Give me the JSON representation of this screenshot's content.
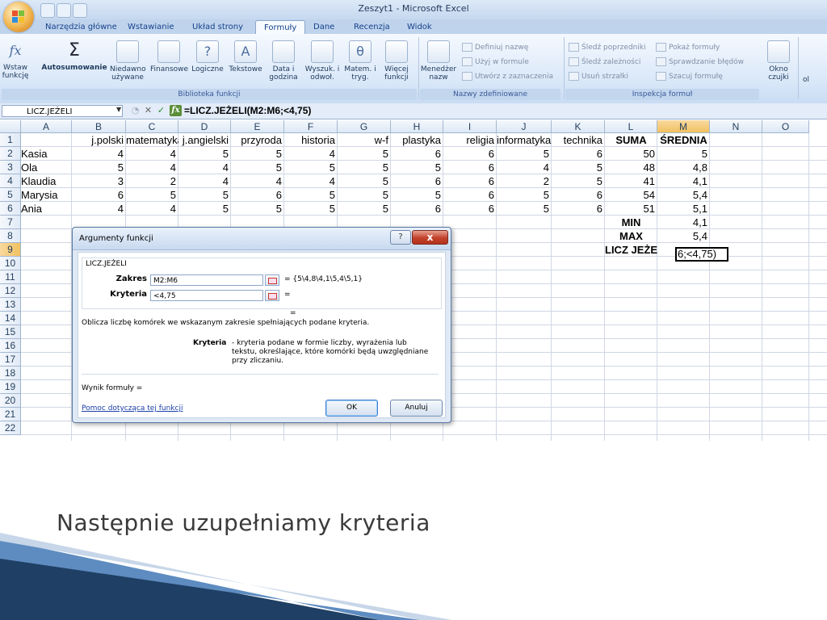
{
  "window": {
    "title": "Zeszyt1 - Microsoft Excel"
  },
  "tabs": [
    {
      "label": "Narzędzia główne"
    },
    {
      "label": "Wstawianie"
    },
    {
      "label": "Układ strony"
    },
    {
      "label": "Formuły",
      "active": true
    },
    {
      "label": "Dane"
    },
    {
      "label": "Recenzja"
    },
    {
      "label": "Widok"
    }
  ],
  "ribbon": {
    "insert_function": "Wstaw funkcję",
    "autosum": "Autosumowanie",
    "recent": "Niedawno używane",
    "financial": "Finansowe",
    "logical": "Logiczne",
    "text": "Tekstowe",
    "datetime": "Data i godzina",
    "lookup": "Wyszuk. i odwoł.",
    "math": "Matem. i tryg.",
    "more": "Więcej funkcji",
    "library_group": "Biblioteka funkcji",
    "name_manager": "Menedżer nazw",
    "define_name": "Definiuj nazwę",
    "use_in_formula": "Użyj w formule",
    "create_from_selection": "Utwórz z zaznaczenia",
    "names_group": "Nazwy zdefiniowane",
    "trace_precedents": "Śledź poprzedniki",
    "trace_dependents": "Śledź zależności",
    "remove_arrows": "Usuń strzałki",
    "show_formulas": "Pokaż formuły",
    "error_checking": "Sprawdzanie błędów",
    "evaluate_formula": "Szacuj formułę",
    "audit_group": "Inspekcja formuł",
    "watch_window": "Okno czujki",
    "calc_partial": "ol"
  },
  "formula_bar": {
    "name_box": "LICZ.JEŻELI",
    "formula": "=LICZ.JEŻELI(M2:M6;<4,75)"
  },
  "columns": [
    "A",
    "B",
    "C",
    "D",
    "E",
    "F",
    "G",
    "H",
    "I",
    "J",
    "K",
    "L",
    "M",
    "N",
    "O"
  ],
  "rows": [
    "1",
    "2",
    "3",
    "4",
    "5",
    "6",
    "7",
    "8",
    "9",
    "10",
    "11",
    "12",
    "13",
    "14",
    "15",
    "16",
    "17",
    "18",
    "19",
    "20",
    "21",
    "22"
  ],
  "sheet": {
    "headers": [
      "j.polski",
      "matematyka",
      "j.angielski",
      "przyroda",
      "historia",
      "w-f",
      "plastyka",
      "religia",
      "informatyka",
      "technika",
      "SUMA",
      "ŚREDNIA"
    ],
    "students": [
      {
        "name": "Kasia",
        "grades": [
          "4",
          "4",
          "5",
          "5",
          "4",
          "5",
          "6",
          "6",
          "5",
          "6"
        ],
        "sum": "50",
        "avg": "5"
      },
      {
        "name": "Ola",
        "grades": [
          "5",
          "4",
          "4",
          "5",
          "5",
          "5",
          "5",
          "6",
          "4",
          "5"
        ],
        "sum": "48",
        "avg": "4,8"
      },
      {
        "name": "Klaudia",
        "grades": [
          "3",
          "2",
          "4",
          "4",
          "4",
          "5",
          "6",
          "6",
          "2",
          "5"
        ],
        "sum": "41",
        "avg": "4,1"
      },
      {
        "name": "Marysia",
        "grades": [
          "6",
          "5",
          "5",
          "6",
          "5",
          "5",
          "5",
          "6",
          "5",
          "6"
        ],
        "sum": "54",
        "avg": "5,4"
      },
      {
        "name": "Ania",
        "grades": [
          "4",
          "4",
          "5",
          "5",
          "5",
          "5",
          "6",
          "6",
          "5",
          "6"
        ],
        "sum": "51",
        "avg": "5,1"
      }
    ],
    "min_label": "MIN",
    "min_value": "4,1",
    "max_label": "MAX",
    "max_value": "5,4",
    "count_label": "LICZ JEŻELI",
    "active_cell_text": "6;<4,75)"
  },
  "dialog": {
    "title": "Argumenty funkcji",
    "function_name": "LICZ.JEŻELI",
    "args": [
      {
        "label": "Zakres",
        "value": "M2:M6",
        "result": "= {5\\4,8\\4,1\\5,4\\5,1}"
      },
      {
        "label": "Kryteria",
        "value": "<4,75",
        "result": "="
      }
    ],
    "eq": "=",
    "description": "Oblicza liczbę komórek we wskazanym zakresie spełniających podane kryteria.",
    "criteria_label": "Kryteria",
    "criteria_description": "- kryteria podane w formie liczby, wyrażenia lub tekstu, określające, które komórki będą uwzględniane przy zliczaniu.",
    "result_label": "Wynik formuły =",
    "help_link": "Pomoc dotycząca tej funkcji",
    "ok": "OK",
    "cancel": "Anuluj",
    "help_glyph": "?",
    "close_glyph": "x"
  },
  "slide": {
    "caption": "Następnie uzupełniamy kryteria"
  },
  "colors": {
    "accent_blue": "#15428b",
    "ribbon_bg": "#d9e7f8",
    "selected_header": "#f1c15f",
    "slide_stripe": "#1f3f64"
  }
}
